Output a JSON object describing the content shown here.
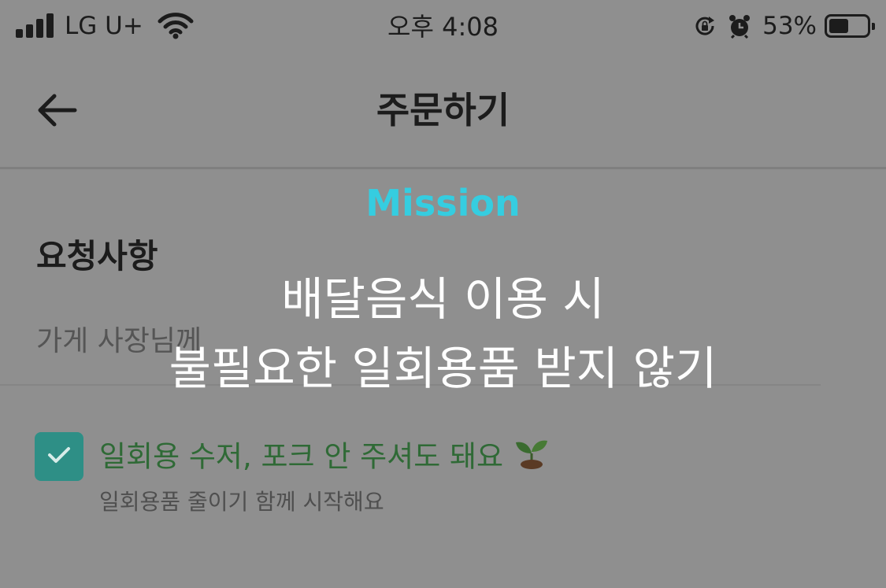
{
  "status_bar": {
    "signal_icon": "cellular-signal-icon",
    "carrier": "LG U+",
    "wifi_icon": "wifi-icon",
    "time": "오후 4:08",
    "rotation_lock_icon": "rotation-lock-icon",
    "alarm_icon": "alarm-clock-icon",
    "battery_percent": "53%",
    "battery_level": 0.53
  },
  "header": {
    "back_icon": "arrow-left-icon",
    "title": "주문하기"
  },
  "request_section": {
    "title": "요청사항",
    "placeholder": "가게 사장님께"
  },
  "utensils_option": {
    "checked": true,
    "check_color": "#2e8f86",
    "label": "일회용 수저, 포크 안 주셔도 돼요",
    "sprout_icon": "sprout-icon",
    "subtext": "일회용품 줄이기 함께 시작해요"
  },
  "mission_overlay": {
    "tag": "Mission",
    "tag_color": "#35cde0",
    "line_1": "배달음식 이용 시",
    "line_2": "불필요한 일회용품 받지 않기"
  }
}
